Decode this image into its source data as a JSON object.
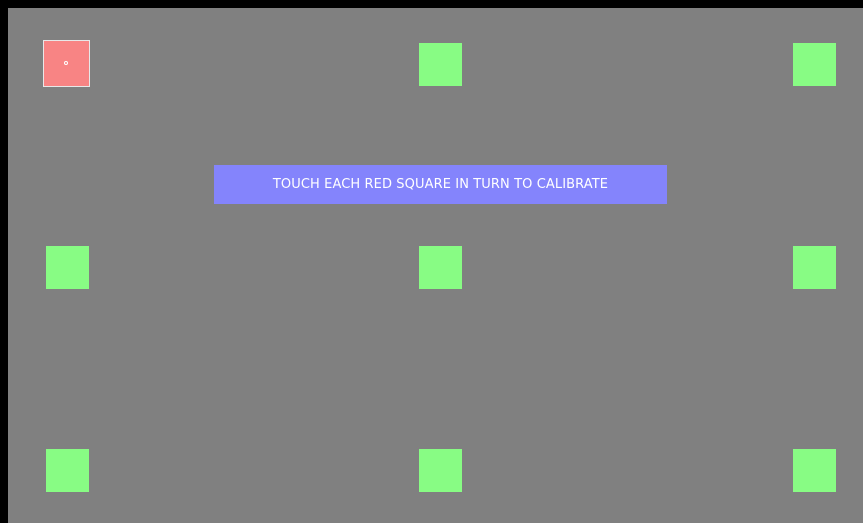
{
  "calibration": {
    "instruction": "TOUCH EACH RED SQUARE IN TURN TO CALIBRATE",
    "targets": [
      {
        "id": "top-left",
        "state": "active"
      },
      {
        "id": "top-center",
        "state": "pending"
      },
      {
        "id": "top-right",
        "state": "pending"
      },
      {
        "id": "middle-left",
        "state": "pending"
      },
      {
        "id": "middle-center",
        "state": "pending"
      },
      {
        "id": "middle-right",
        "state": "pending"
      },
      {
        "id": "bottom-left",
        "state": "pending"
      },
      {
        "id": "bottom-center",
        "state": "pending"
      },
      {
        "id": "bottom-right",
        "state": "pending"
      }
    ]
  },
  "colors": {
    "background": "#808080",
    "frame": "#000000",
    "active_target": "#f88484",
    "pending_target": "#88fc84",
    "banner": "#8484fc",
    "banner_text": "#ffffff"
  }
}
